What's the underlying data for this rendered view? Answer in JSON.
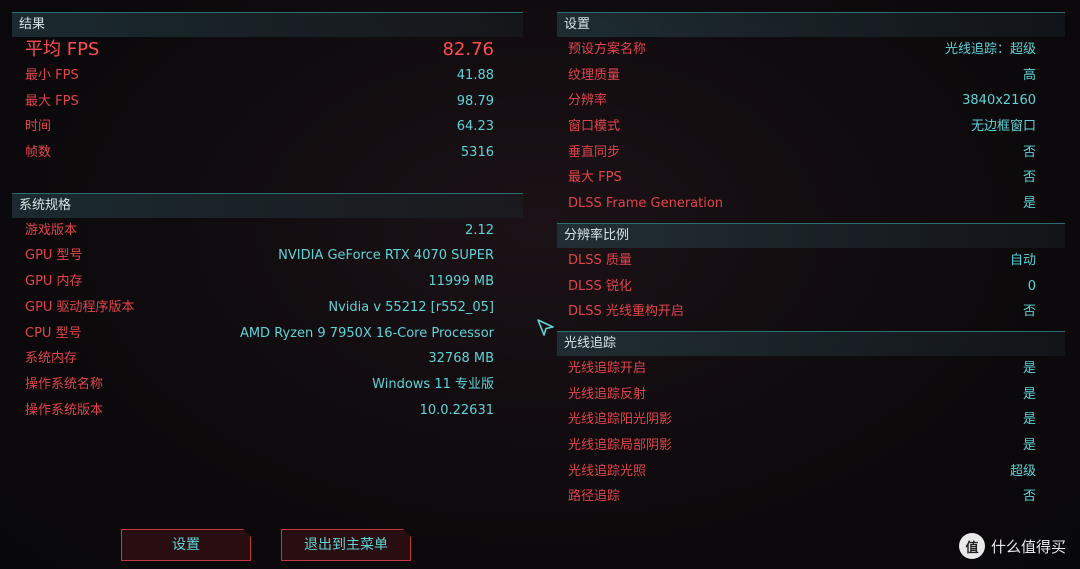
{
  "results": {
    "header": "结果",
    "avg_fps": {
      "label": "平均 FPS",
      "value": "82.76"
    },
    "rows": [
      {
        "label": "最小 FPS",
        "value": "41.88"
      },
      {
        "label": "最大 FPS",
        "value": "98.79"
      },
      {
        "label": "时间",
        "value": "64.23"
      },
      {
        "label": "帧数",
        "value": "5316"
      }
    ]
  },
  "system": {
    "header": "系统规格",
    "rows": [
      {
        "label": "游戏版本",
        "value": "2.12"
      },
      {
        "label": "GPU 型号",
        "value": "NVIDIA GeForce RTX 4070 SUPER"
      },
      {
        "label": "GPU 内存",
        "value": "11999 MB"
      },
      {
        "label": "GPU 驱动程序版本",
        "value": "Nvidia v 55212 [r552_05]"
      },
      {
        "label": "CPU 型号",
        "value": "AMD Ryzen 9 7950X 16-Core Processor"
      },
      {
        "label": "系统内存",
        "value": "32768 MB"
      },
      {
        "label": "操作系统名称",
        "value": "Windows 11 专业版"
      },
      {
        "label": "操作系统版本",
        "value": "10.0.22631"
      }
    ]
  },
  "settings": {
    "header": "设置",
    "rows": [
      {
        "label": "预设方案名称",
        "value": "光线追踪：超级"
      },
      {
        "label": "纹理质量",
        "value": "高"
      },
      {
        "label": "分辨率",
        "value": "3840x2160"
      },
      {
        "label": "窗口模式",
        "value": "无边框窗口"
      },
      {
        "label": "垂直同步",
        "value": "否"
      },
      {
        "label": "最大 FPS",
        "value": "否"
      },
      {
        "label": "DLSS Frame Generation",
        "value": "是"
      }
    ]
  },
  "resolution_scaling": {
    "header": "分辨率比例",
    "rows": [
      {
        "label": "DLSS 质量",
        "value": "自动"
      },
      {
        "label": "DLSS 锐化",
        "value": "0"
      },
      {
        "label": "DLSS 光线重构开启",
        "value": "否"
      }
    ]
  },
  "ray_tracing": {
    "header": "光线追踪",
    "rows": [
      {
        "label": "光线追踪开启",
        "value": "是"
      },
      {
        "label": "光线追踪反射",
        "value": "是"
      },
      {
        "label": "光线追踪阳光阴影",
        "value": "是"
      },
      {
        "label": "光线追踪局部阴影",
        "value": "是"
      },
      {
        "label": "光线追踪光照",
        "value": "超级"
      },
      {
        "label": "路径追踪",
        "value": "否"
      }
    ]
  },
  "buttons": {
    "settings_label": "设置",
    "exit_label": "退出到主菜单"
  },
  "watermark": {
    "badge": "值",
    "text": "什么值得买"
  },
  "colors": {
    "label_red": "#e0454b",
    "value_cyan": "#5fd3d8",
    "header_line": "#2c6c73",
    "button_border": "#c23a40"
  }
}
